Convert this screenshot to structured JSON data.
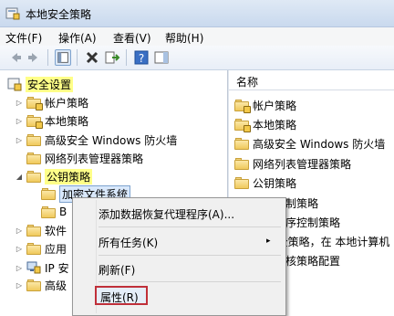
{
  "window": {
    "title": "本地安全策略"
  },
  "menu": [
    "文件(F)",
    "操作(A)",
    "查看(V)",
    "帮助(H)"
  ],
  "tree": {
    "root": "安全设置",
    "items": [
      {
        "label": "帐户策略"
      },
      {
        "label": "本地策略"
      },
      {
        "label": "高级安全 Windows 防火墙"
      },
      {
        "label": "网络列表管理器策略"
      },
      {
        "label": "公钥策略"
      },
      {
        "label": "加密文件系统"
      },
      {
        "label": "B"
      },
      {
        "label": "软件"
      },
      {
        "label": "应用"
      },
      {
        "label": "IP 安"
      },
      {
        "label": "高级"
      }
    ]
  },
  "list": {
    "header": "名称",
    "rows": [
      "帐户策略",
      "本地策略",
      "高级安全 Windows 防火墙",
      "网络列表管理器策略",
      "公钥策略",
      "软件限制策略",
      "应用程序控制策略",
      "IP 安全策略，在 本地计算机",
      "高级审核策略配置"
    ]
  },
  "context_menu": {
    "items": [
      "添加数据恢复代理程序(A)...",
      "所有任务(K)",
      "刷新(F)",
      "属性(R)"
    ],
    "submenu_arrow": "▸"
  },
  "colors": {
    "highlight_yellow": "#ffff88",
    "properties_outline": "#c0303a"
  }
}
